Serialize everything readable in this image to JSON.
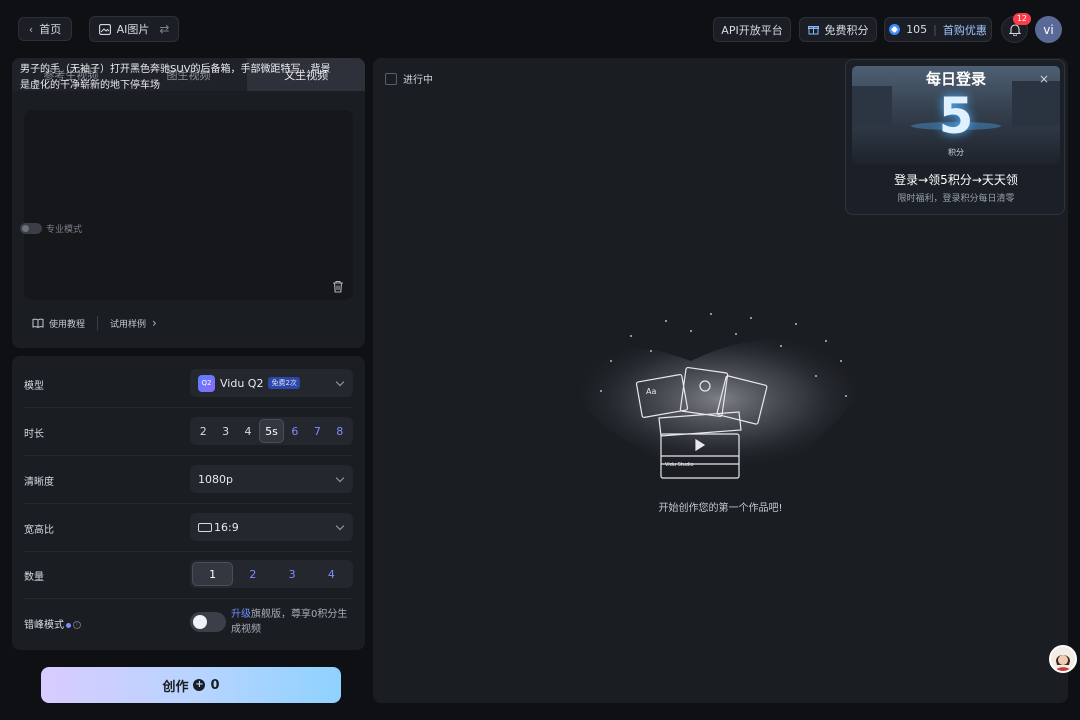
{
  "topbar": {
    "home_label": "首页",
    "ai_image_label": "AI图片",
    "api_label": "API开放平台",
    "free_points_label": "免费积分",
    "points_value": "105",
    "first_purchase_label": "首购优惠",
    "notification_count": "12",
    "avatar_text": "vi"
  },
  "tabs": [
    {
      "label": "参考生视频",
      "active": false
    },
    {
      "label": "图生视频",
      "active": false
    },
    {
      "label": "文生视频",
      "active": true
    }
  ],
  "prompt": {
    "text": "男子的手（无袖子）打开黑色奔驰SUV的后备箱，手部微距特写，背景是虚化的干净崭新的地下停车场",
    "pro_mode_label": "专业模式"
  },
  "links": {
    "tutorial": "使用教程",
    "examples": "试用样例"
  },
  "settings": {
    "model": {
      "label": "模型",
      "icon_text": "Q2",
      "value": "Vidu Q2",
      "tag": "免费2次"
    },
    "duration": {
      "label": "时长",
      "options": [
        "2",
        "3",
        "4",
        "5s",
        "6",
        "7",
        "8"
      ],
      "selected": "5s"
    },
    "resolution": {
      "label": "清晰度",
      "value": "1080p"
    },
    "aspect": {
      "label": "宽高比",
      "value": "16:9"
    },
    "count": {
      "label": "数量",
      "options": [
        "1",
        "2",
        "3",
        "4"
      ],
      "selected": "1"
    },
    "peak": {
      "label": "错峰模式",
      "upgrade": "升级",
      "text": "旗舰版，尊享0积分生成视频"
    }
  },
  "create": {
    "label": "创作",
    "cost": "0"
  },
  "main": {
    "in_progress_label": "进行中",
    "empty_text": "开始创作您的第一个作品吧!",
    "illus_label": "Vidu Studio"
  },
  "popup": {
    "title": "每日登录",
    "big_number": "5",
    "unit": "积分",
    "line1": "登录→领5积分→天天领",
    "line2": "限时福利，登录积分每日清零"
  },
  "colors": {
    "accent_blue": "#7f8dff",
    "background": "#0e1014",
    "panel": "#1a1d22"
  }
}
